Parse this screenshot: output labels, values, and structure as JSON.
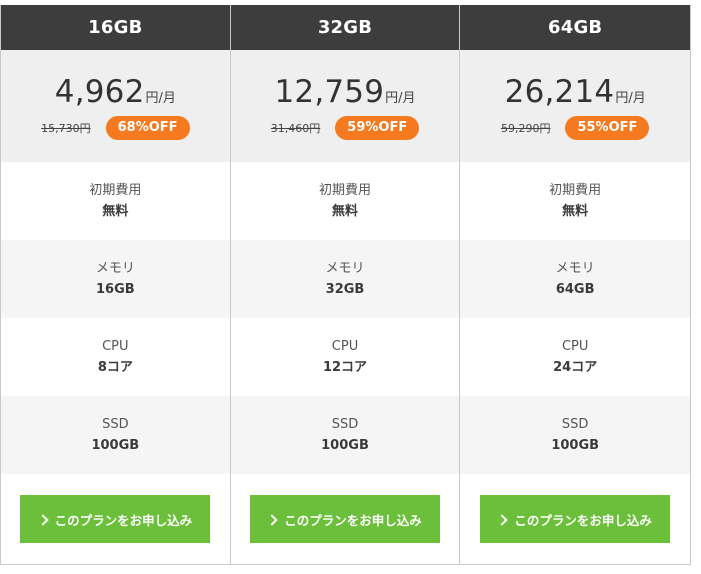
{
  "colors": {
    "header_bg": "#3d3d3d",
    "price_bg": "#efefef",
    "badge_orange": "#f5791f",
    "cta_green": "#6cbf3a"
  },
  "plans": [
    {
      "name": "16GB",
      "price": "4,962",
      "price_unit": "円/月",
      "old_price": "15,730円",
      "discount": "68%OFF",
      "specs": [
        {
          "label": "初期費用",
          "value": "無料"
        },
        {
          "label": "メモリ",
          "value": "16GB"
        },
        {
          "label": "CPU",
          "value": "8コア"
        },
        {
          "label": "SSD",
          "value": "100GB"
        }
      ],
      "cta_label": "このプランをお申し込み",
      "cta_icon": "chevron-right-icon"
    },
    {
      "name": "32GB",
      "price": "12,759",
      "price_unit": "円/月",
      "old_price": "31,460円",
      "discount": "59%OFF",
      "specs": [
        {
          "label": "初期費用",
          "value": "無料"
        },
        {
          "label": "メモリ",
          "value": "32GB"
        },
        {
          "label": "CPU",
          "value": "12コア"
        },
        {
          "label": "SSD",
          "value": "100GB"
        }
      ],
      "cta_label": "このプランをお申し込み",
      "cta_icon": "chevron-right-icon"
    },
    {
      "name": "64GB",
      "price": "26,214",
      "price_unit": "円/月",
      "old_price": "59,290円",
      "discount": "55%OFF",
      "specs": [
        {
          "label": "初期費用",
          "value": "無料"
        },
        {
          "label": "メモリ",
          "value": "64GB"
        },
        {
          "label": "CPU",
          "value": "24コア"
        },
        {
          "label": "SSD",
          "value": "100GB"
        }
      ],
      "cta_label": "このプランをお申し込み",
      "cta_icon": "chevron-right-icon"
    }
  ]
}
